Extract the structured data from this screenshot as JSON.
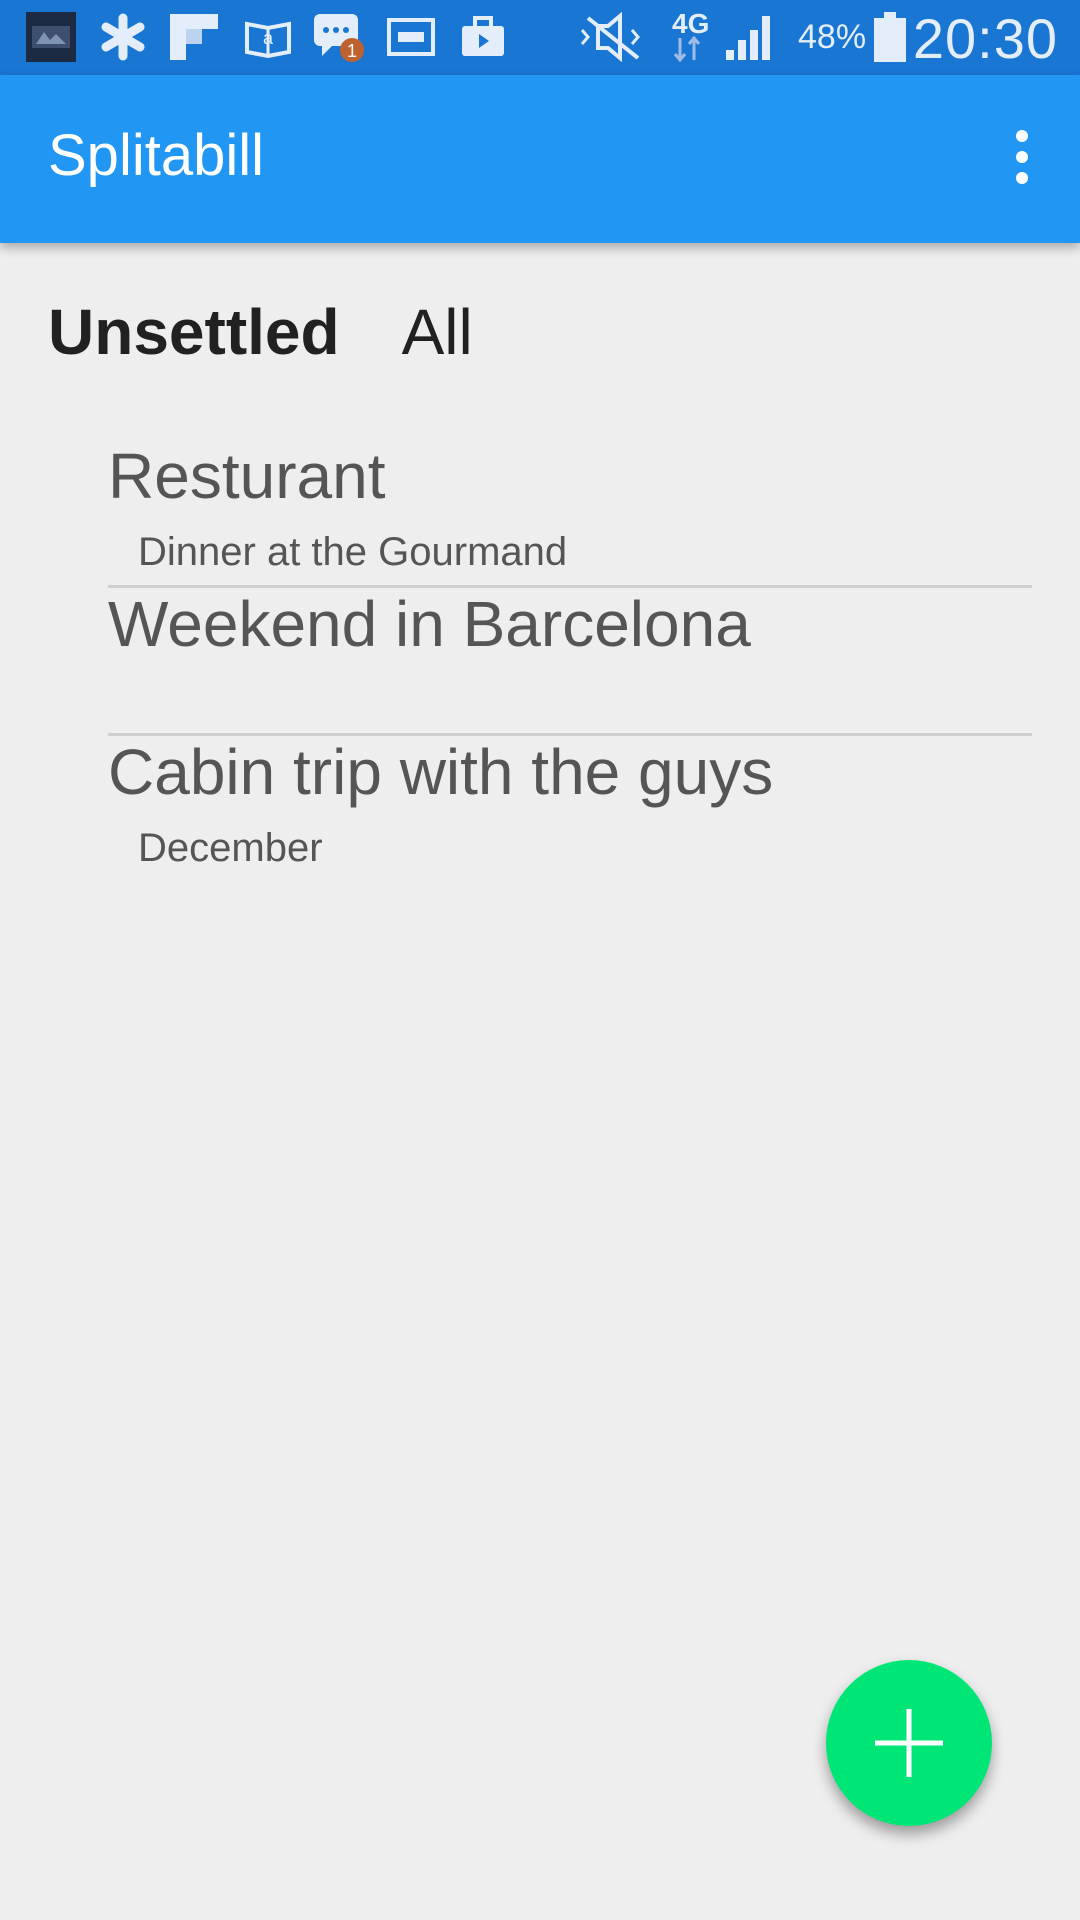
{
  "status_bar": {
    "notification_badge": "1",
    "network_type": "4G",
    "battery_percent": "48%",
    "time": "20:30",
    "icons": [
      "app-thumbnail-icon",
      "asterisk-icon",
      "flipboard-icon",
      "amazon-kindle-icon",
      "messaging-icon",
      "ticket-icon",
      "briefcase-icon",
      "mute-icon",
      "signal-icon",
      "battery-icon"
    ],
    "colors": {
      "background": "#1976d2"
    }
  },
  "app_bar": {
    "title": "Splitabill",
    "overflow_icon": "more-vert-icon",
    "colors": {
      "background": "#2196f3"
    }
  },
  "tabs": [
    {
      "label": "Unsettled",
      "selected": true
    },
    {
      "label": "All",
      "selected": false
    }
  ],
  "list": {
    "items": [
      {
        "title": "Resturant",
        "subtitle": "Dinner at the Gourmand"
      },
      {
        "title": "Weekend in Barcelona",
        "subtitle": ""
      },
      {
        "title": "Cabin trip with the guys",
        "subtitle": "December"
      }
    ]
  },
  "fab": {
    "icon": "plus-icon",
    "color": "#00e676"
  }
}
